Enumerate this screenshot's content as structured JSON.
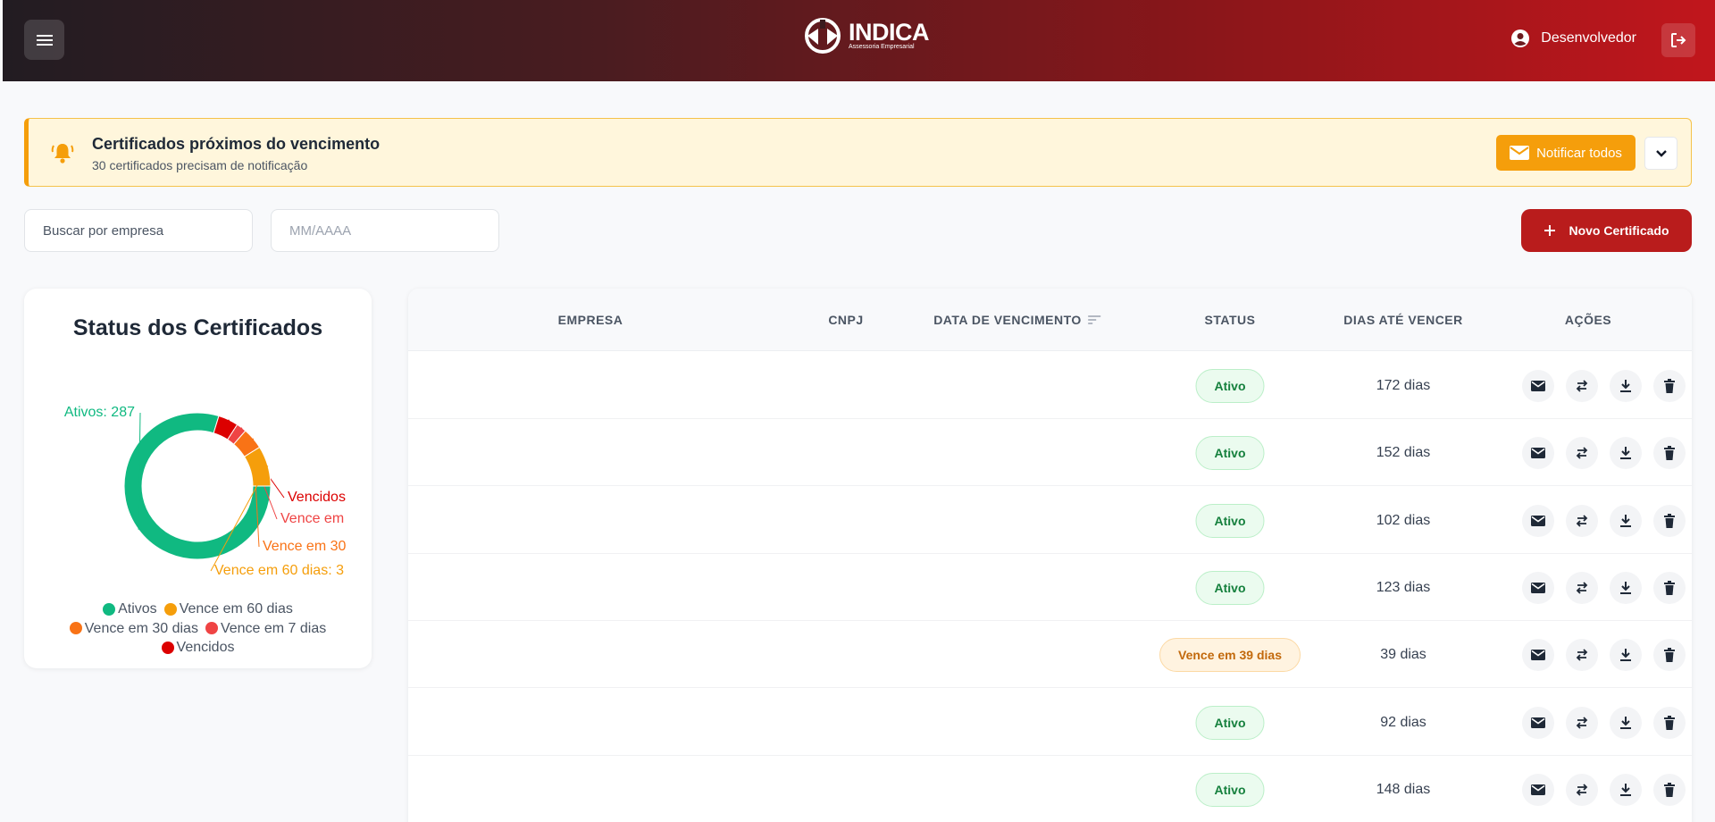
{
  "header": {
    "logo_text": "INDICA",
    "logo_subtitle": "Assessoria Empresarial",
    "user_name": "Desenvolvedor"
  },
  "alert": {
    "title": "Certificados próximos do vencimento",
    "subtitle": "30 certificados precisam de notificação",
    "notify_label": "Notificar todos"
  },
  "filters": {
    "search_placeholder": "Buscar por empresa",
    "date_placeholder": "MM/AAAA",
    "new_label": "Novo Certificado"
  },
  "chart_card": {
    "title": "Status dos Certificados",
    "legend": [
      {
        "label": "Ativos",
        "color": "#10b981"
      },
      {
        "label": "Vence em 60 dias",
        "color": "#f59e0b"
      },
      {
        "label": "Vence em 30 dias",
        "color": "#f97316"
      },
      {
        "label": "Vence em 7 dias",
        "color": "#ef4444"
      },
      {
        "label": "Vencidos",
        "color": "#dc0000"
      }
    ]
  },
  "chart_data": {
    "type": "pie",
    "title": "Status dos Certificados",
    "donut": true,
    "categories": [
      "Ativos",
      "Vencidos",
      "Vence em 7 dias",
      "Vence em 30 dias",
      "Vence em 60 dias"
    ],
    "values": [
      287,
      16,
      8,
      17,
      32
    ],
    "colors": [
      "#10b981",
      "#dc0000",
      "#ef4444",
      "#f97316",
      "#f59e0b"
    ],
    "data_labels": [
      "Ativos: 287",
      "Vencidos",
      "Vence em",
      "Vence em 30",
      "Vence em 60 dias: 3"
    ],
    "legend_position": "bottom"
  },
  "table": {
    "headers": [
      "EMPRESA",
      "CNPJ",
      "DATA DE VENCIMENTO",
      "STATUS",
      "DIAS ATÉ VENCER",
      "AÇÕES"
    ],
    "rows": [
      {
        "status": "Ativo",
        "status_type": "ok",
        "days": "172 dias"
      },
      {
        "status": "Ativo",
        "status_type": "ok",
        "days": "152 dias"
      },
      {
        "status": "Ativo",
        "status_type": "ok",
        "days": "102 dias"
      },
      {
        "status": "Ativo",
        "status_type": "ok",
        "days": "123 dias"
      },
      {
        "status": "Vence em 39 dias",
        "status_type": "warn",
        "days": "39 dias"
      },
      {
        "status": "Ativo",
        "status_type": "ok",
        "days": "92 dias"
      },
      {
        "status": "Ativo",
        "status_type": "ok",
        "days": "148 dias"
      }
    ],
    "actions": [
      "mail-icon",
      "renew-icon",
      "download-icon",
      "delete-icon"
    ]
  }
}
